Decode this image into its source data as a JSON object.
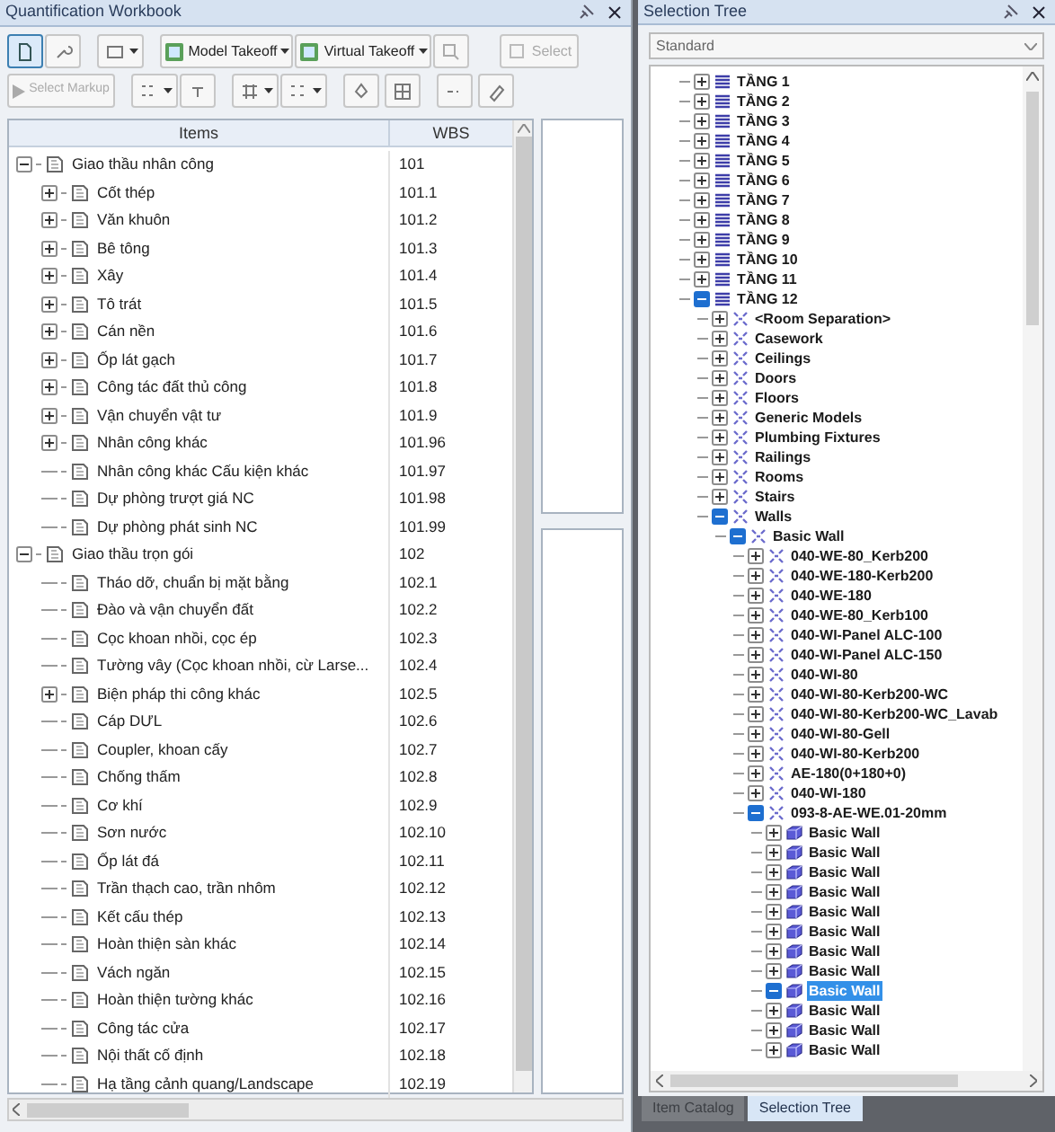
{
  "workbook": {
    "title": "Quantification Workbook",
    "toolbar": {
      "view_selected": true,
      "model_takeoff": "Model Takeoff",
      "virtual_takeoff": "Virtual Takeoff",
      "select": {
        "label": "Select",
        "disabled": true
      },
      "select_markup": {
        "label": "Select Markup",
        "disabled": true
      }
    },
    "columns": [
      "Items",
      "WBS"
    ],
    "items": [
      {
        "label": "Giao thầu nhân công",
        "wbs": "101",
        "expanded": true,
        "children": [
          {
            "label": "Cốt thép",
            "wbs": "101.1",
            "expanded": false
          },
          {
            "label": "Văn khuôn",
            "wbs": "101.2",
            "expanded": false
          },
          {
            "label": "Bê tông",
            "wbs": "101.3",
            "expanded": false
          },
          {
            "label": "Xây",
            "wbs": "101.4",
            "expanded": false
          },
          {
            "label": "Tô trát",
            "wbs": "101.5",
            "expanded": false
          },
          {
            "label": "Cán nền",
            "wbs": "101.6",
            "expanded": false
          },
          {
            "label": "Ốp lát gạch",
            "wbs": "101.7",
            "expanded": false
          },
          {
            "label": "Công tác đất thủ công",
            "wbs": "101.8",
            "expanded": false
          },
          {
            "label": "Vận chuyển vật tư",
            "wbs": "101.9",
            "expanded": false
          },
          {
            "label": "Nhân công khác",
            "wbs": "101.96",
            "expanded": false
          },
          {
            "label": "Nhân công khác Cấu kiện khác",
            "wbs": "101.97"
          },
          {
            "label": "Dự phòng trượt giá NC",
            "wbs": "101.98"
          },
          {
            "label": "Dự phòng phát sinh NC",
            "wbs": "101.99"
          }
        ]
      },
      {
        "label": "Giao thầu trọn gói",
        "wbs": "102",
        "expanded": true,
        "children": [
          {
            "label": "Tháo dỡ, chuẩn bị mặt bằng",
            "wbs": "102.1"
          },
          {
            "label": "Đào và vận chuyển đất",
            "wbs": "102.2"
          },
          {
            "label": "Cọc khoan nhồi, cọc ép",
            "wbs": "102.3"
          },
          {
            "label": "Tường vây (Cọc khoan nhồi, cừ Larse...",
            "wbs": "102.4"
          },
          {
            "label": "Biện pháp thi công khác",
            "wbs": "102.5",
            "expanded": false
          },
          {
            "label": "Cáp DƯL",
            "wbs": "102.6"
          },
          {
            "label": "Coupler, khoan cấy",
            "wbs": "102.7"
          },
          {
            "label": "Chống thấm",
            "wbs": "102.8"
          },
          {
            "label": "Cơ khí",
            "wbs": "102.9"
          },
          {
            "label": "Sơn nước",
            "wbs": "102.10"
          },
          {
            "label": "Ốp lát đá",
            "wbs": "102.11"
          },
          {
            "label": "Trần thạch cao, trần nhôm",
            "wbs": "102.12"
          },
          {
            "label": "Kết cấu thép",
            "wbs": "102.13"
          },
          {
            "label": "Hoàn thiện sàn khác",
            "wbs": "102.14"
          },
          {
            "label": "Vách ngăn",
            "wbs": "102.15"
          },
          {
            "label": "Hoàn thiện tường khác",
            "wbs": "102.16"
          },
          {
            "label": "Công tác cửa",
            "wbs": "102.17"
          },
          {
            "label": "Nội thất cố định",
            "wbs": "102.18"
          },
          {
            "label": "Hạ tầng cảnh quang/Landscape",
            "wbs": "102.19"
          }
        ]
      }
    ]
  },
  "selection_tree": {
    "title": "Selection Tree",
    "mode": "Standard",
    "nodes": [
      {
        "label": "TẦNG 1",
        "kind": "level",
        "expanded": false,
        "selected": false
      },
      {
        "label": "TẦNG 2",
        "kind": "level",
        "expanded": false,
        "selected": false
      },
      {
        "label": "TẦNG 3",
        "kind": "level",
        "expanded": false,
        "selected": false
      },
      {
        "label": "TẦNG 4",
        "kind": "level",
        "expanded": false,
        "selected": false
      },
      {
        "label": "TẦNG 5",
        "kind": "level",
        "expanded": false,
        "selected": false
      },
      {
        "label": "TẦNG 6",
        "kind": "level",
        "expanded": false,
        "selected": false
      },
      {
        "label": "TẦNG 7",
        "kind": "level",
        "expanded": false,
        "selected": false
      },
      {
        "label": "TẦNG 8",
        "kind": "level",
        "expanded": false,
        "selected": false
      },
      {
        "label": "TẦNG 9",
        "kind": "level",
        "expanded": false,
        "selected": false
      },
      {
        "label": "TẦNG 10",
        "kind": "level",
        "expanded": false,
        "selected": false
      },
      {
        "label": "TẦNG 11",
        "kind": "level",
        "expanded": false,
        "selected": false
      },
      {
        "label": "TẦNG 12",
        "kind": "level",
        "expanded": true,
        "selected": false,
        "children": [
          {
            "label": "<Room Separation>",
            "kind": "category",
            "expanded": false,
            "selected": false
          },
          {
            "label": "Casework",
            "kind": "category",
            "expanded": false,
            "selected": false
          },
          {
            "label": "Ceilings",
            "kind": "category",
            "expanded": false,
            "selected": false
          },
          {
            "label": "Doors",
            "kind": "category",
            "expanded": false,
            "selected": false
          },
          {
            "label": "Floors",
            "kind": "category",
            "expanded": false,
            "selected": false
          },
          {
            "label": "Generic Models",
            "kind": "category",
            "expanded": false,
            "selected": false
          },
          {
            "label": "Plumbing Fixtures",
            "kind": "category",
            "expanded": false,
            "selected": false
          },
          {
            "label": "Railings",
            "kind": "category",
            "expanded": false,
            "selected": false
          },
          {
            "label": "Rooms",
            "kind": "category",
            "expanded": false,
            "selected": false
          },
          {
            "label": "Stairs",
            "kind": "category",
            "expanded": false,
            "selected": false
          },
          {
            "label": "Walls",
            "kind": "category",
            "expanded": true,
            "selected": false,
            "children": [
              {
                "label": "Basic Wall",
                "kind": "category",
                "expanded": true,
                "selected": false,
                "children": [
                  {
                    "label": "040-WE-80_Kerb200",
                    "kind": "category",
                    "expanded": false,
                    "selected": false
                  },
                  {
                    "label": "040-WE-180-Kerb200",
                    "kind": "category",
                    "expanded": false,
                    "selected": false
                  },
                  {
                    "label": "040-WE-180",
                    "kind": "category",
                    "expanded": false,
                    "selected": false
                  },
                  {
                    "label": "040-WE-80_Kerb100",
                    "kind": "category",
                    "expanded": false,
                    "selected": false
                  },
                  {
                    "label": "040-WI-Panel ALC-100",
                    "kind": "category",
                    "expanded": false,
                    "selected": false
                  },
                  {
                    "label": "040-WI-Panel ALC-150",
                    "kind": "category",
                    "expanded": false,
                    "selected": false
                  },
                  {
                    "label": "040-WI-80",
                    "kind": "category",
                    "expanded": false,
                    "selected": false
                  },
                  {
                    "label": "040-WI-80-Kerb200-WC",
                    "kind": "category",
                    "expanded": false,
                    "selected": false
                  },
                  {
                    "label": "040-WI-80-Kerb200-WC_Lavab",
                    "kind": "category",
                    "expanded": false,
                    "selected": false
                  },
                  {
                    "label": "040-WI-80-Gell",
                    "kind": "category",
                    "expanded": false,
                    "selected": false
                  },
                  {
                    "label": "040-WI-80-Kerb200",
                    "kind": "category",
                    "expanded": false,
                    "selected": false
                  },
                  {
                    "label": "AE-180(0+180+0)",
                    "kind": "category",
                    "expanded": false,
                    "selected": false
                  },
                  {
                    "label": "040-WI-180",
                    "kind": "category",
                    "expanded": false,
                    "selected": false
                  },
                  {
                    "label": "093-8-AE-WE.01-20mm",
                    "kind": "category",
                    "expanded": true,
                    "selected": false,
                    "children": [
                      {
                        "label": "Basic Wall",
                        "kind": "element",
                        "expanded": false,
                        "selected": false
                      },
                      {
                        "label": "Basic Wall",
                        "kind": "element",
                        "expanded": false,
                        "selected": false
                      },
                      {
                        "label": "Basic Wall",
                        "kind": "element",
                        "expanded": false,
                        "selected": false
                      },
                      {
                        "label": "Basic Wall",
                        "kind": "element",
                        "expanded": false,
                        "selected": false
                      },
                      {
                        "label": "Basic Wall",
                        "kind": "element",
                        "expanded": false,
                        "selected": false
                      },
                      {
                        "label": "Basic Wall",
                        "kind": "element",
                        "expanded": false,
                        "selected": false
                      },
                      {
                        "label": "Basic Wall",
                        "kind": "element",
                        "expanded": false,
                        "selected": false
                      },
                      {
                        "label": "Basic Wall",
                        "kind": "element",
                        "expanded": false,
                        "selected": false
                      },
                      {
                        "label": "Basic Wall",
                        "kind": "element",
                        "expanded": true,
                        "selected": true
                      },
                      {
                        "label": "Basic Wall",
                        "kind": "element",
                        "expanded": false,
                        "selected": false
                      },
                      {
                        "label": "Basic Wall",
                        "kind": "element",
                        "expanded": false,
                        "selected": false
                      },
                      {
                        "label": "Basic Wall",
                        "kind": "element",
                        "expanded": false,
                        "selected": false
                      }
                    ]
                  }
                ]
              }
            ]
          }
        ]
      }
    ],
    "tabs": [
      {
        "label": "Item Catalog",
        "selected": false
      },
      {
        "label": "Selection Tree",
        "selected": true
      }
    ]
  }
}
